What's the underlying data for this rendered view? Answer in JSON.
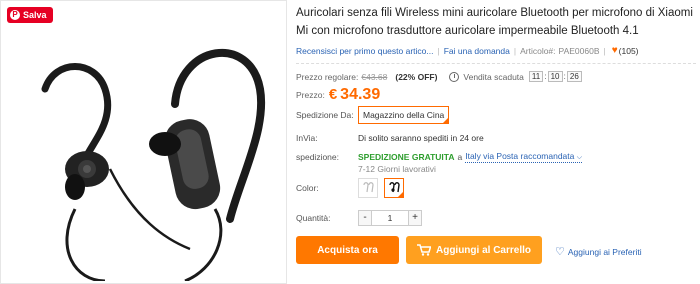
{
  "save_badge": {
    "label": "Salva",
    "icon": "pinterest-icon"
  },
  "product": {
    "title": "Auricolari senza fili Wireless mini auricolare Bluetooth per microfono di Xiaomi Mi con microfono trasduttore auricolare impermeabile Bluetooth 4.1"
  },
  "meta": {
    "reviews_link": "Recensisci per primo questo artico...",
    "question_link": "Fai una domanda",
    "article_label": "Articolo#:",
    "article_value": "PAE0060B",
    "likes": "(105)"
  },
  "pricing": {
    "regular_label": "Prezzo regolare:",
    "regular_value": "€43.68",
    "discount": "(22% OFF)",
    "expired_label": "Vendita scaduta",
    "timer": [
      "11",
      "10",
      "26"
    ],
    "price_label": "Prezzo:",
    "currency": "€",
    "price": "34.39"
  },
  "shipping": {
    "from_label": "Spedizione Da:",
    "from_value": "Magazzino della Cina",
    "send_label": "InVia:",
    "send_value": "Di solito saranno spediti in 24 ore",
    "method_label": "spedizione:",
    "free_label": "SPEDIZIONE GRATUITA",
    "method_to": "a",
    "method_link": "Italy via Posta raccomandata",
    "days": "7-12 Giorni lavorativi"
  },
  "color": {
    "label": "Color:",
    "selected_index": 1,
    "accent": "#ff6a00"
  },
  "quantity": {
    "label": "Quantità:",
    "value": "1",
    "minus": "-",
    "plus": "+"
  },
  "actions": {
    "buy_now": "Acquista ora",
    "add_to_cart": "Aggiungi al Carrello",
    "wishlist": "Aggiungi ai Preferiti"
  },
  "colors": {
    "primary_orange": "#ff7800",
    "cart_orange": "#ffa01f",
    "link_blue": "#2a63b4",
    "free_green": "#2e9e2e"
  }
}
